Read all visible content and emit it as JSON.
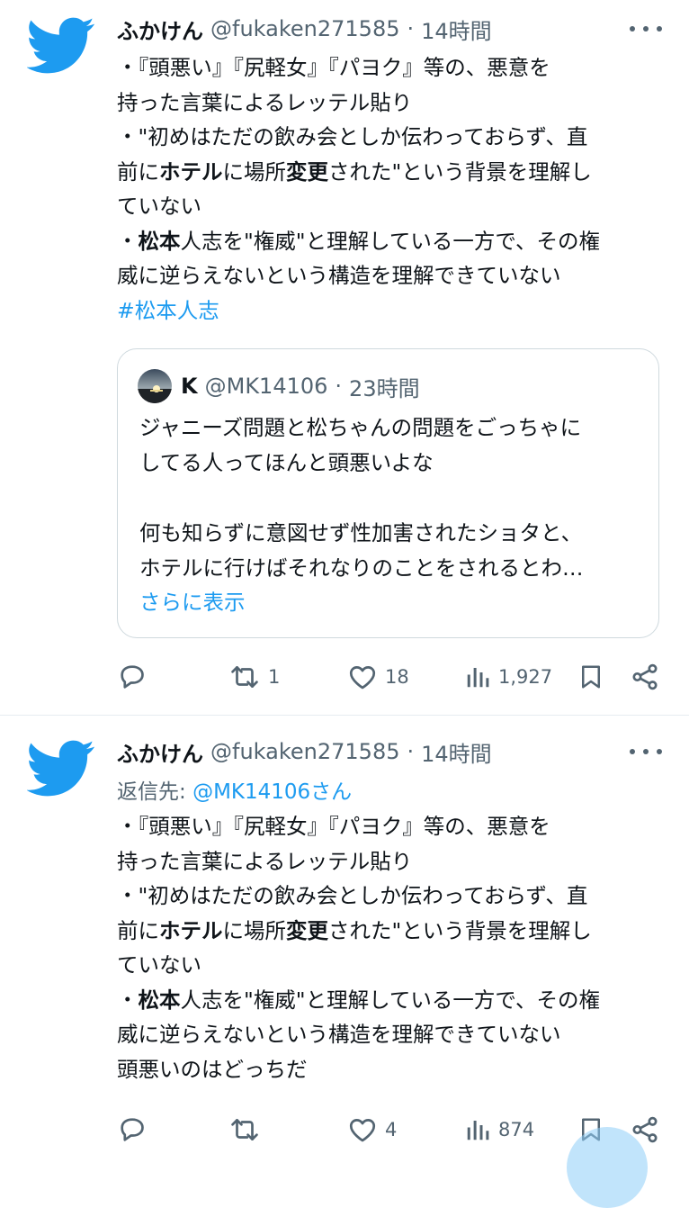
{
  "colors": {
    "accent": "#1d9bf0",
    "text": "#0f1419",
    "muted": "#536471",
    "border": "#cfd9de"
  },
  "tweets": [
    {
      "author": {
        "name": "ふかけん",
        "handle": "@fukaken271585",
        "avatar_icon": "twitter-bird-icon"
      },
      "dot": "·",
      "time": "14時間",
      "body": {
        "l1": "・『頭悪い』『尻軽女』『パヨク』等の、悪意を",
        "l2": "持った言葉によるレッテル貼り",
        "l3": "・\"初めはただの飲み会としか伝わっておらず、直",
        "l4a": "前に",
        "l4b": "ホテル",
        "l4c": "に場所",
        "l4d": "変更",
        "l4e": "された\"という背景を理解し",
        "l5": "ていない",
        "l6a": "・",
        "l6b": "松本",
        "l6c": "人志を\"権威\"と理解している一方で、その権",
        "l7": "威に逆らえないという構造を理解できていない",
        "hashtag": "#松本人志"
      },
      "quote": {
        "name": "K",
        "handle": "@MK14106",
        "dot": "·",
        "time": "23時間",
        "l1": "ジャニーズ問題と松ちゃんの問題をごっちゃに",
        "l2": "してる人ってほんと頭悪いよな",
        "l3": "何も知らずに意図せず性加害されたショタと、",
        "l4": "ホテルに行けばそれなりのことをされるとわ…",
        "show_more": "さらに表示"
      },
      "actions": {
        "replies": "",
        "retweets": "1",
        "likes": "18",
        "views": "1,927"
      }
    },
    {
      "author": {
        "name": "ふかけん",
        "handle": "@fukaken271585",
        "avatar_icon": "twitter-bird-icon"
      },
      "dot": "·",
      "time": "14時間",
      "reply_to": {
        "prefix": "返信先: ",
        "mention": "@MK14106",
        "suffix": "さん"
      },
      "body": {
        "l1": "・『頭悪い』『尻軽女』『パヨク』等の、悪意を",
        "l2": "持った言葉によるレッテル貼り",
        "l3": "・\"初めはただの飲み会としか伝わっておらず、直",
        "l4a": "前に",
        "l4b": "ホテル",
        "l4c": "に場所",
        "l4d": "変更",
        "l4e": "された\"という背景を理解し",
        "l5": "ていない",
        "l6a": "・",
        "l6b": "松本",
        "l6c": "人志を\"権威\"と理解している一方で、その権",
        "l7": "威に逆らえないという構造を理解できていない",
        "l8": "頭悪いのはどっちだ"
      },
      "actions": {
        "replies": "",
        "retweets": "",
        "likes": "4",
        "views": "874"
      }
    }
  ]
}
